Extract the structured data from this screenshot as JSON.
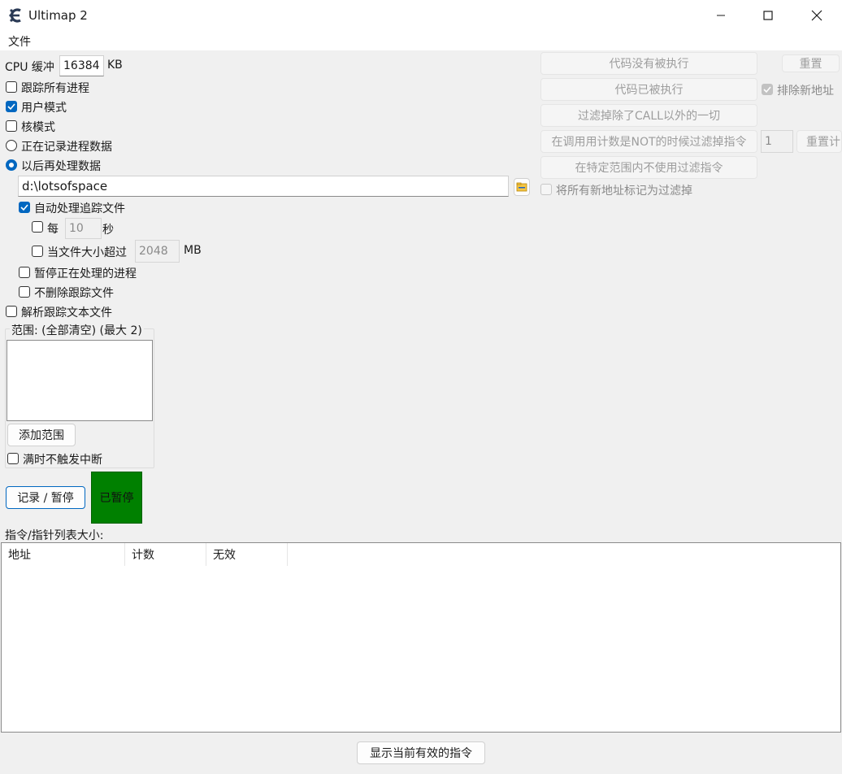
{
  "window": {
    "title": "Ultimap 2",
    "app_icon": "cheat-engine-icon"
  },
  "menu": {
    "file": "文件"
  },
  "left": {
    "cpu_buffer_label": "CPU 缓冲",
    "cpu_buffer_value": "16384",
    "cpu_buffer_unit": "KB",
    "trace_all_processes": {
      "label": "跟踪所有进程",
      "checked": false
    },
    "user_mode": {
      "label": "用户模式",
      "checked": true
    },
    "kernel_mode": {
      "label": "核模式",
      "checked": false
    },
    "record_live": {
      "label": "正在记录进程数据",
      "selected": false
    },
    "process_later": {
      "label": "以后再处理数据",
      "selected": true
    },
    "path_value": "d:\\lotsofspace",
    "auto_process": {
      "label": "自动处理追踪文件",
      "checked": true
    },
    "every": {
      "label": "每",
      "value": "10",
      "unit": "秒",
      "checked": false
    },
    "file_size": {
      "label": "当文件大小超过",
      "value": "2048",
      "unit": "MB",
      "checked": false
    },
    "pause_process": {
      "label": "暂停正在处理的进程",
      "checked": false
    },
    "keep_trace_files": {
      "label": "不删除跟踪文件",
      "checked": false
    },
    "parse_text": {
      "label": "解析跟踪文本文件",
      "checked": false
    },
    "range_group_title": "范围: (全部清空) (最大 2)",
    "add_range_button": "添加范围",
    "no_break_when_full": {
      "label": "满时不触发中断",
      "checked": false
    },
    "record_pause_button": "记录 / 暂停",
    "status_paused": "已暂停",
    "status_color": "#008000",
    "list_size_label": "指令/指针列表大小:"
  },
  "right": {
    "code_not_executed": "代码没有被执行",
    "reset_button": "重置",
    "code_executed": "代码已被执行",
    "exclude_new_addresses": {
      "label": "排除新地址",
      "checked": true
    },
    "filter_non_call": "过滤掉除了CALL以外的一切",
    "filter_by_call_count": "在调用用计数是NOT的时候过滤掉指令",
    "call_count_value": "1",
    "reset_count_button": "重置计",
    "no_filter_in_range": "在特定范围内不使用过滤指令",
    "mark_new_filtered": {
      "label": "将所有新地址标记为过滤掉",
      "checked": false
    }
  },
  "list": {
    "columns": [
      "地址",
      "计数",
      "无效"
    ]
  },
  "footer": {
    "show_valid_button": "显示当前有效的指令"
  },
  "colors": {
    "accent": "#0067c0",
    "background": "#f0f0f0"
  }
}
